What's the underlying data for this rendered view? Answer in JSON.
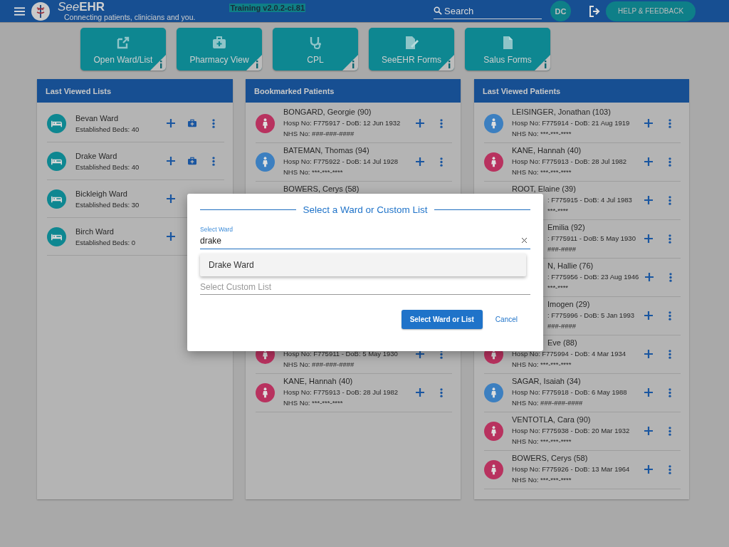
{
  "topbar": {
    "brand": "See**EHR**",
    "tagline": "Connecting patients, clinicians and you.",
    "build": "Training v2.0.2-ci.81",
    "search": {
      "placeholder": "Search"
    },
    "user_initials": "DC",
    "help_button": "HELP & FEEDBACK"
  },
  "tiles": [
    {
      "label": "Open Ward/List"
    },
    {
      "label": "Pharmacy View"
    },
    {
      "label": "CPL"
    },
    {
      "label": "SeeEHR Forms"
    },
    {
      "label": "Salus Forms"
    }
  ],
  "panels": [
    {
      "title": "Last Viewed Lists",
      "kind": "wards",
      "rows": [
        {
          "kind": "full",
          "name": "Bevan Ward",
          "beds": "Established Beds: 40"
        },
        {
          "kind": "full",
          "name": "Drake Ward",
          "beds": "Established Beds: 40"
        },
        {
          "kind": "actions-covered",
          "name": "Bickleigh Ward",
          "beds": "Established Beds: 30"
        },
        {
          "kind": "actions-covered",
          "name": "Birch Ward",
          "beds": "Established Beds: 0"
        }
      ]
    },
    {
      "title": "Bookmarked Patients",
      "kind": "patients",
      "rows": [
        {
          "kind": "full",
          "color": "#b8325f",
          "name": "BONGARD, Georgie (90)",
          "hosp": "Hosp No: F775917 - DoB: 12 Jun 1932",
          "nhs": "NHS No: ###-###-####"
        },
        {
          "kind": "full",
          "color": "#3c7fc0",
          "name": "BATEMAN, Thomas (94)",
          "hosp": "Hosp No: F775922 - DoB: 14 Jul 1928",
          "nhs": "NHS No: ***-***-****"
        },
        {
          "kind": "name-only",
          "name": "BOWERS, Cerys (58)"
        },
        {
          "kind": "name-covered",
          "color": "#b8325f",
          "hosp": "Hosp No: F775911 - DoB: 5 May 1930",
          "nhs": "NHS No: ###-###-####"
        },
        {
          "kind": "full",
          "color": "#b8325f",
          "name": "KANE, Hannah (40)",
          "hosp": "Hosp No: F775913 - DoB: 28 Jul 1982",
          "nhs": "NHS No: ***-***-****"
        }
      ]
    },
    {
      "title": "Last Viewed Patients",
      "kind": "patients",
      "rows": [
        {
          "kind": "full",
          "color": "#3c7fc0",
          "name": "LEISINGER, Jonathan (103)",
          "hosp": "Hosp No: F775914 - DoB: 21 Aug 1919",
          "nhs": "NHS No: ***-***-****"
        },
        {
          "kind": "full",
          "color": "#b8325f",
          "name": "KANE, Hannah (40)",
          "hosp": "Hosp No: F775913 - DoB: 28 Jul 1982",
          "nhs": "NHS No: ***-***-****"
        },
        {
          "kind": "lines-covered",
          "name": "ROOT, Elaine (39)",
          "hosp": ": F775915 - DoB: 4 Jul 1983",
          "nhs": "***-****"
        },
        {
          "kind": "covered",
          "name": "Emilia (92)",
          "hosp": ": F775911 - DoB: 5 May 1930",
          "nhs": "###-####"
        },
        {
          "kind": "covered",
          "name": "N, Hallie (76)",
          "hosp": ": F775956 - DoB: 23 Aug 1946",
          "nhs": "***-****"
        },
        {
          "kind": "covered",
          "name": "Imogen (29)",
          "hosp": ": F775996 - DoB: 5 Jan 1993",
          "nhs": "###-####"
        },
        {
          "kind": "name-covered",
          "color": "#b8325f",
          "name": "Eve (88)",
          "hosp": "Hosp No: F775994 - DoB: 4 Mar 1934",
          "nhs": "NHS No: ***-***-****"
        },
        {
          "kind": "full",
          "color": "#3c7fc0",
          "name": "SAGAR, Isaiah (34)",
          "hosp": "Hosp No: F775918 - DoB: 6 May 1988",
          "nhs": "NHS No: ###-###-####"
        },
        {
          "kind": "full",
          "color": "#b8325f",
          "name": "VENTOTLA, Cara (90)",
          "hosp": "Hosp No: F775938 - DoB: 20 Mar 1932",
          "nhs": "NHS No: ***-***-****"
        },
        {
          "kind": "full",
          "color": "#b8325f",
          "name": "BOWERS, Cerys (58)",
          "hosp": "Hosp No: F775926 - DoB: 13 Mar 1964",
          "nhs": "NHS No: ***-***-****"
        }
      ]
    }
  ],
  "dialog": {
    "title": "Select a Ward or Custom List",
    "ward_field": {
      "label": "Select Ward",
      "value": "drake"
    },
    "options": [
      {
        "label": "Drake Ward"
      }
    ],
    "custom_field": {
      "placeholder": "Select Custom List"
    },
    "confirm_button": "Select Ward or List",
    "cancel_button": "Cancel"
  }
}
